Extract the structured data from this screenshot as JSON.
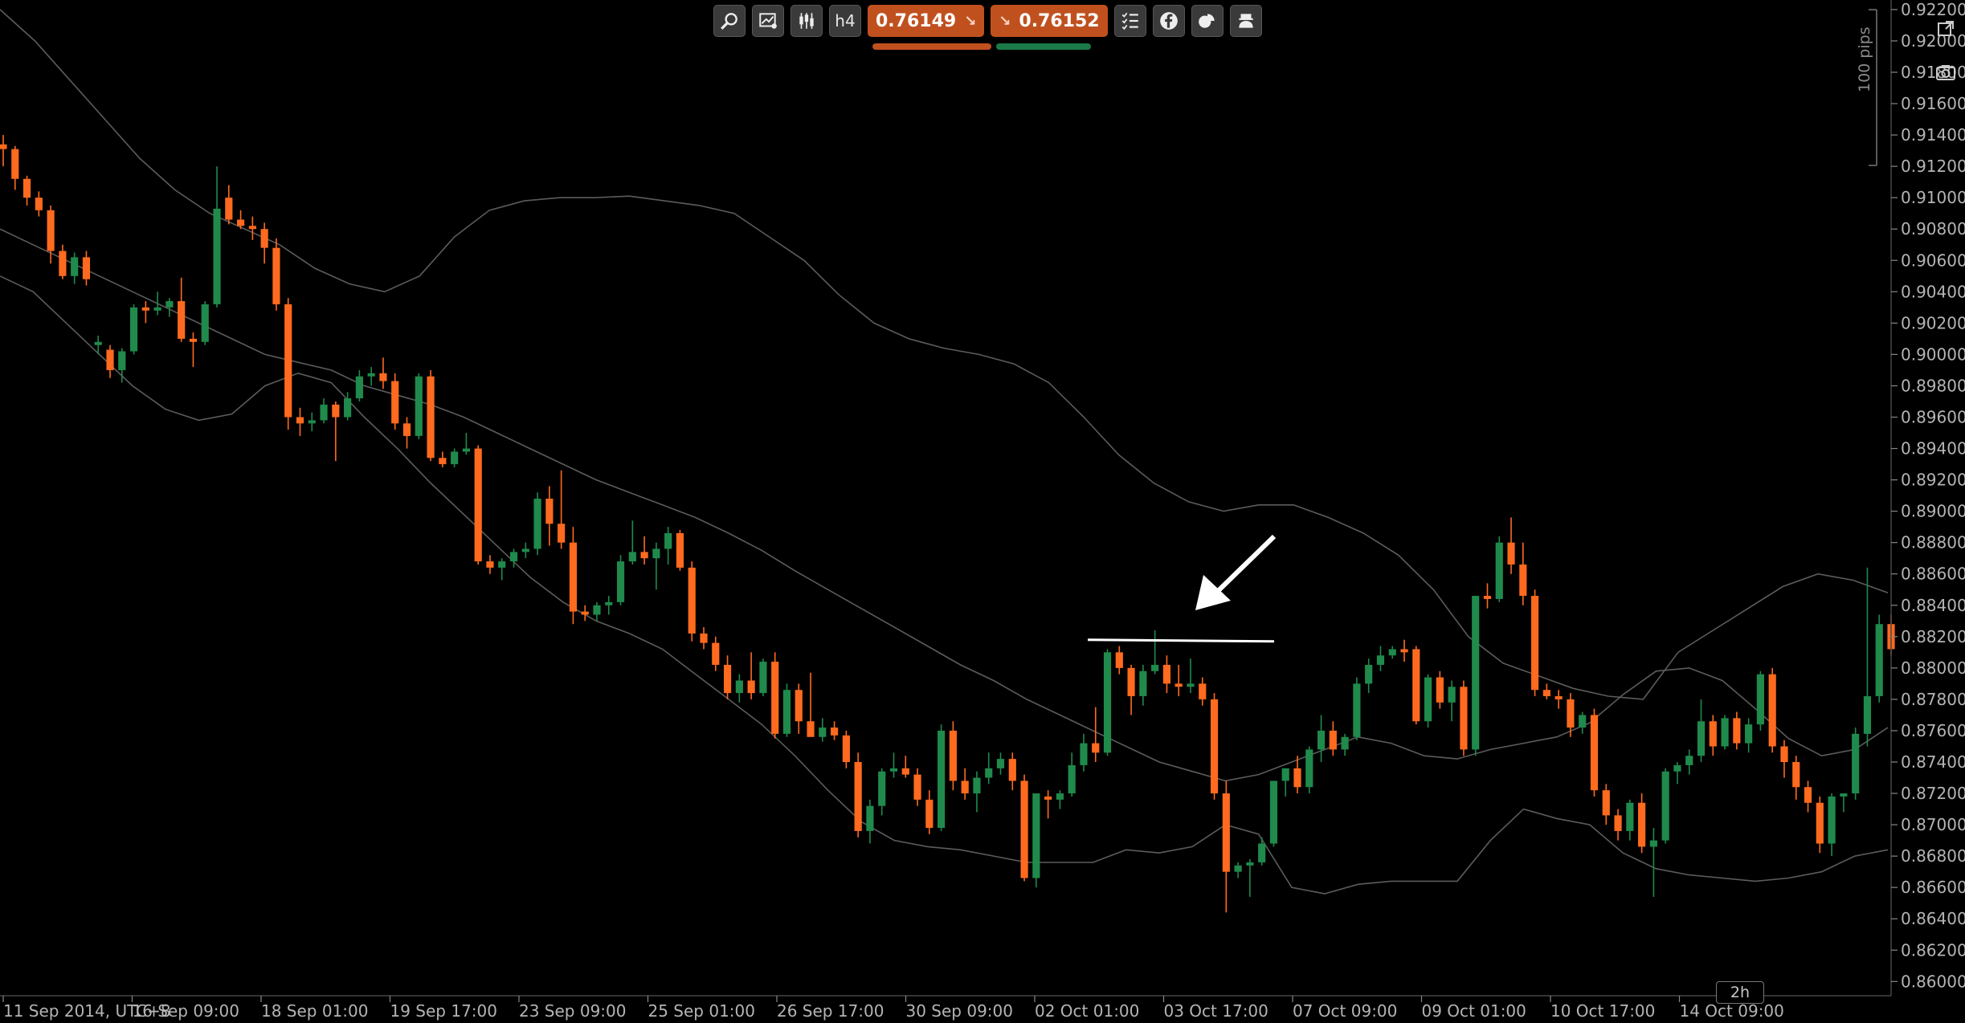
{
  "toolbar": {
    "icons": [
      "zoom-icon",
      "chart-settings-icon",
      "chart-type-icon",
      "timeframe-icon",
      "watchlist-icon",
      "social-icon",
      "sentiment-icon",
      "trader-icon"
    ],
    "timeframe": "h4",
    "sell_price": "0.76149",
    "buy_price": "0.76152",
    "sell_color": "#c0511f",
    "buy_color": "#c0511f",
    "sell_bar_color": "#c0511f",
    "buy_bar_color": "#1a7a48"
  },
  "side": {
    "pips_label": "100 pips",
    "timeframe_badge": "2h"
  },
  "chart_data": {
    "type": "candlestick",
    "bull_color": "#1f8a4c",
    "bear_color": "#ff6a1f",
    "band_color": "#5c5c5c",
    "y_ticks": [
      "0.92200",
      "0.92000",
      "0.91800",
      "0.91600",
      "0.91400",
      "0.91200",
      "0.91000",
      "0.90800",
      "0.90600",
      "0.90400",
      "0.90200",
      "0.90000",
      "0.89800",
      "0.89600",
      "0.89400",
      "0.89200",
      "0.89000",
      "0.88800",
      "0.88600",
      "0.88400",
      "0.88200",
      "0.88000",
      "0.87800",
      "0.87600",
      "0.87400",
      "0.87200",
      "0.87000",
      "0.86800",
      "0.86600",
      "0.86400",
      "0.86200",
      "0.86000"
    ],
    "x_ticks": [
      "11 Sep 2014, UTC+8",
      "16 Sep 09:00",
      "18 Sep 01:00",
      "19 Sep 17:00",
      "23 Sep 09:00",
      "25 Sep 01:00",
      "26 Sep 17:00",
      "30 Sep 09:00",
      "02 Oct 01:00",
      "03 Oct 17:00",
      "07 Oct 09:00",
      "09 Oct 01:00",
      "10 Oct 17:00",
      "14 Oct 09:00"
    ],
    "ylim": [
      0.8593,
      0.9222
    ],
    "candles": [
      [
        0.9134,
        0.914,
        0.912,
        0.9131
      ],
      [
        0.9131,
        0.9133,
        0.9105,
        0.9112
      ],
      [
        0.9112,
        0.9114,
        0.9095,
        0.91
      ],
      [
        0.91,
        0.9104,
        0.9088,
        0.9092
      ],
      [
        0.9092,
        0.9095,
        0.9058,
        0.9066
      ],
      [
        0.9066,
        0.907,
        0.9048,
        0.905
      ],
      [
        0.905,
        0.9065,
        0.9045,
        0.9062
      ],
      [
        0.9062,
        0.9066,
        0.9044,
        0.9048
      ],
      [
        0.9006,
        0.9012,
        0.9,
        0.9008
      ],
      [
        0.9003,
        0.9006,
        0.8985,
        0.899
      ],
      [
        0.899,
        0.9004,
        0.8982,
        0.9002
      ],
      [
        0.9002,
        0.9032,
        0.9,
        0.903
      ],
      [
        0.903,
        0.9034,
        0.902,
        0.9028
      ],
      [
        0.9028,
        0.904,
        0.9025,
        0.903
      ],
      [
        0.903,
        0.9036,
        0.9024,
        0.9034
      ],
      [
        0.9034,
        0.9049,
        0.9008,
        0.901
      ],
      [
        0.901,
        0.9014,
        0.8992,
        0.9008
      ],
      [
        0.9008,
        0.9034,
        0.9006,
        0.9032
      ],
      [
        0.9032,
        0.912,
        0.903,
        0.9093
      ],
      [
        0.91,
        0.9108,
        0.9083,
        0.9086
      ],
      [
        0.9086,
        0.9092,
        0.908,
        0.9082
      ],
      [
        0.9082,
        0.9088,
        0.9073,
        0.908
      ],
      [
        0.908,
        0.9084,
        0.9058,
        0.9068
      ],
      [
        0.9068,
        0.9074,
        0.9028,
        0.9032
      ],
      [
        0.9032,
        0.9036,
        0.8952,
        0.896
      ],
      [
        0.896,
        0.8966,
        0.8948,
        0.8956
      ],
      [
        0.8956,
        0.8963,
        0.8951,
        0.8958
      ],
      [
        0.8958,
        0.8972,
        0.8956,
        0.8968
      ],
      [
        0.8968,
        0.897,
        0.8932,
        0.896
      ],
      [
        0.896,
        0.8976,
        0.8958,
        0.8972
      ],
      [
        0.8972,
        0.899,
        0.897,
        0.8986
      ],
      [
        0.8986,
        0.8992,
        0.898,
        0.8988
      ],
      [
        0.8988,
        0.8998,
        0.8978,
        0.8983
      ],
      [
        0.8983,
        0.8988,
        0.8952,
        0.8956
      ],
      [
        0.8956,
        0.896,
        0.894,
        0.8948
      ],
      [
        0.8948,
        0.8988,
        0.8946,
        0.8986
      ],
      [
        0.8986,
        0.899,
        0.8932,
        0.8934
      ],
      [
        0.8934,
        0.8938,
        0.8928,
        0.893
      ],
      [
        0.893,
        0.894,
        0.8928,
        0.8938
      ],
      [
        0.8938,
        0.895,
        0.8936,
        0.894
      ],
      [
        0.894,
        0.8942,
        0.8866,
        0.8868
      ],
      [
        0.8868,
        0.8872,
        0.886,
        0.8864
      ],
      [
        0.8864,
        0.887,
        0.8856,
        0.8868
      ],
      [
        0.8868,
        0.8876,
        0.8864,
        0.8874
      ],
      [
        0.8874,
        0.888,
        0.887,
        0.8876
      ],
      [
        0.8876,
        0.8912,
        0.8872,
        0.8908
      ],
      [
        0.8908,
        0.8916,
        0.8878,
        0.8892
      ],
      [
        0.8892,
        0.8926,
        0.8876,
        0.888
      ],
      [
        0.888,
        0.889,
        0.8828,
        0.8836
      ],
      [
        0.8836,
        0.884,
        0.883,
        0.8834
      ],
      [
        0.8834,
        0.8842,
        0.883,
        0.884
      ],
      [
        0.884,
        0.8846,
        0.8834,
        0.8842
      ],
      [
        0.8842,
        0.8872,
        0.884,
        0.8868
      ],
      [
        0.8868,
        0.8894,
        0.8866,
        0.8874
      ],
      [
        0.8874,
        0.8884,
        0.8866,
        0.887
      ],
      [
        0.887,
        0.888,
        0.885,
        0.8876
      ],
      [
        0.8876,
        0.889,
        0.8866,
        0.8886
      ],
      [
        0.8886,
        0.8888,
        0.8862,
        0.8864
      ],
      [
        0.8864,
        0.8868,
        0.8817,
        0.8822
      ],
      [
        0.8822,
        0.8826,
        0.8812,
        0.8816
      ],
      [
        0.8816,
        0.882,
        0.8798,
        0.8802
      ],
      [
        0.8802,
        0.8808,
        0.878,
        0.8784
      ],
      [
        0.8784,
        0.8796,
        0.8778,
        0.8792
      ],
      [
        0.8792,
        0.881,
        0.878,
        0.8784
      ],
      [
        0.8784,
        0.8806,
        0.8782,
        0.8804
      ],
      [
        0.8804,
        0.881,
        0.8755,
        0.8758
      ],
      [
        0.8758,
        0.879,
        0.8756,
        0.8786
      ],
      [
        0.8786,
        0.879,
        0.8758,
        0.8766
      ],
      [
        0.8766,
        0.8797,
        0.876,
        0.8756
      ],
      [
        0.8756,
        0.8768,
        0.8753,
        0.8762
      ],
      [
        0.8762,
        0.8766,
        0.8754,
        0.8757
      ],
      [
        0.8757,
        0.876,
        0.8736,
        0.874
      ],
      [
        0.874,
        0.8746,
        0.8692,
        0.8696
      ],
      [
        0.8696,
        0.8716,
        0.8688,
        0.8712
      ],
      [
        0.8712,
        0.8736,
        0.8706,
        0.8734
      ],
      [
        0.8734,
        0.8746,
        0.873,
        0.8736
      ],
      [
        0.8736,
        0.8744,
        0.873,
        0.8732
      ],
      [
        0.8732,
        0.8736,
        0.8712,
        0.8716
      ],
      [
        0.8716,
        0.8722,
        0.8694,
        0.8698
      ],
      [
        0.8698,
        0.8764,
        0.8696,
        0.876
      ],
      [
        0.876,
        0.8766,
        0.8722,
        0.8728
      ],
      [
        0.8728,
        0.8736,
        0.8716,
        0.872
      ],
      [
        0.872,
        0.8734,
        0.8708,
        0.873
      ],
      [
        0.873,
        0.8746,
        0.8726,
        0.8736
      ],
      [
        0.8736,
        0.8746,
        0.8732,
        0.8742
      ],
      [
        0.8742,
        0.8746,
        0.8722,
        0.8728
      ],
      [
        0.8728,
        0.8732,
        0.8664,
        0.8666
      ],
      [
        0.8666,
        0.8672,
        0.866,
        0.872
      ],
      [
        0.8718,
        0.8722,
        0.8704,
        0.8716
      ],
      [
        0.8716,
        0.8722,
        0.871,
        0.872
      ],
      [
        0.872,
        0.8746,
        0.8718,
        0.8738
      ],
      [
        0.8738,
        0.8758,
        0.8734,
        0.8752
      ],
      [
        0.8752,
        0.8775,
        0.874,
        0.8746
      ],
      [
        0.8746,
        0.8812,
        0.8744,
        0.881
      ],
      [
        0.881,
        0.8814,
        0.8796,
        0.88
      ],
      [
        0.88,
        0.8802,
        0.877,
        0.8782
      ],
      [
        0.8782,
        0.8802,
        0.8776,
        0.8798
      ],
      [
        0.8798,
        0.8824,
        0.8796,
        0.8802
      ],
      [
        0.8802,
        0.8808,
        0.8784,
        0.879
      ],
      [
        0.879,
        0.8802,
        0.8782,
        0.8788
      ],
      [
        0.8788,
        0.8806,
        0.8784,
        0.879
      ],
      [
        0.879,
        0.8794,
        0.8776,
        0.878
      ],
      [
        0.878,
        0.8784,
        0.8716,
        0.872
      ],
      [
        0.872,
        0.8728,
        0.8644,
        0.867
      ],
      [
        0.867,
        0.8676,
        0.8666,
        0.8674
      ],
      [
        0.8674,
        0.8678,
        0.8654,
        0.8676
      ],
      [
        0.8676,
        0.8692,
        0.8674,
        0.8688
      ],
      [
        0.8688,
        0.8728,
        0.8686,
        0.8728
      ],
      [
        0.8728,
        0.8736,
        0.8718,
        0.8736
      ],
      [
        0.8736,
        0.8744,
        0.872,
        0.8724
      ],
      [
        0.8724,
        0.875,
        0.872,
        0.8748
      ],
      [
        0.8748,
        0.877,
        0.874,
        0.876
      ],
      [
        0.876,
        0.8766,
        0.8744,
        0.8748
      ],
      [
        0.8748,
        0.8758,
        0.8744,
        0.8756
      ],
      [
        0.8756,
        0.8794,
        0.8754,
        0.879
      ],
      [
        0.879,
        0.8806,
        0.8784,
        0.8802
      ],
      [
        0.8802,
        0.8814,
        0.8798,
        0.8808
      ],
      [
        0.8808,
        0.8814,
        0.8806,
        0.8812
      ],
      [
        0.8812,
        0.8818,
        0.8804,
        0.881
      ],
      [
        0.8812,
        0.8814,
        0.8764,
        0.8766
      ],
      [
        0.8766,
        0.8796,
        0.8762,
        0.8794
      ],
      [
        0.8794,
        0.8798,
        0.8774,
        0.8778
      ],
      [
        0.8778,
        0.8792,
        0.8766,
        0.8788
      ],
      [
        0.8788,
        0.8792,
        0.8744,
        0.8748
      ],
      [
        0.8748,
        0.8846,
        0.8744,
        0.8846
      ],
      [
        0.8846,
        0.8854,
        0.8838,
        0.8844
      ],
      [
        0.8844,
        0.8884,
        0.8842,
        0.888
      ],
      [
        0.888,
        0.8896,
        0.886,
        0.8866
      ],
      [
        0.8866,
        0.888,
        0.884,
        0.8846
      ],
      [
        0.8846,
        0.885,
        0.8782,
        0.8786
      ],
      [
        0.8786,
        0.879,
        0.878,
        0.8782
      ],
      [
        0.8782,
        0.8786,
        0.8774,
        0.878
      ],
      [
        0.878,
        0.8784,
        0.8756,
        0.8762
      ],
      [
        0.8762,
        0.8772,
        0.8758,
        0.877
      ],
      [
        0.877,
        0.8774,
        0.8718,
        0.8722
      ],
      [
        0.8722,
        0.8726,
        0.87,
        0.8706
      ],
      [
        0.8706,
        0.871,
        0.869,
        0.8696
      ],
      [
        0.8696,
        0.8716,
        0.869,
        0.8714
      ],
      [
        0.8714,
        0.872,
        0.8682,
        0.8686
      ],
      [
        0.8686,
        0.8698,
        0.8654,
        0.869
      ],
      [
        0.869,
        0.8736,
        0.8688,
        0.8734
      ],
      [
        0.8734,
        0.874,
        0.8726,
        0.8738
      ],
      [
        0.8738,
        0.8748,
        0.8732,
        0.8744
      ],
      [
        0.8744,
        0.878,
        0.874,
        0.8766
      ],
      [
        0.8766,
        0.877,
        0.8744,
        0.875
      ],
      [
        0.875,
        0.877,
        0.8748,
        0.8768
      ],
      [
        0.8768,
        0.8772,
        0.8748,
        0.8752
      ],
      [
        0.8752,
        0.8768,
        0.8746,
        0.8764
      ],
      [
        0.8764,
        0.8798,
        0.876,
        0.8796
      ],
      [
        0.8796,
        0.88,
        0.8746,
        0.875
      ],
      [
        0.875,
        0.8754,
        0.873,
        0.874
      ],
      [
        0.874,
        0.8744,
        0.8716,
        0.8724
      ],
      [
        0.8724,
        0.8728,
        0.8708,
        0.8714
      ],
      [
        0.8714,
        0.8718,
        0.8682,
        0.8688
      ],
      [
        0.8688,
        0.872,
        0.868,
        0.8718
      ],
      [
        0.8718,
        0.872,
        0.8708,
        0.872
      ],
      [
        0.872,
        0.8762,
        0.8716,
        0.8758
      ],
      [
        0.8758,
        0.8864,
        0.875,
        0.8782
      ],
      [
        0.8782,
        0.8834,
        0.8778,
        0.8828
      ],
      [
        0.8828,
        0.8834,
        0.8808,
        0.8812
      ]
    ],
    "upper_band": [
      0.922,
      0.92,
      0.9175,
      0.915,
      0.9125,
      0.9105,
      0.909,
      0.908,
      0.907,
      0.9055,
      0.9045,
      0.904,
      0.905,
      0.9075,
      0.9092,
      0.9098,
      0.91,
      0.91,
      0.9101,
      0.9098,
      0.9095,
      0.909,
      0.9075,
      0.906,
      0.9038,
      0.902,
      0.901,
      0.9004,
      0.9,
      0.8994,
      0.8982,
      0.896,
      0.8936,
      0.8918,
      0.8906,
      0.89,
      0.8904,
      0.8904,
      0.8896,
      0.8886,
      0.8872,
      0.885,
      0.882,
      0.8803,
      0.8795,
      0.8787,
      0.8782,
      0.878,
      0.881,
      0.8824,
      0.8838,
      0.8852,
      0.886,
      0.8856,
      0.8848
    ],
    "middle_band": [
      0.908,
      0.907,
      0.906,
      0.905,
      0.904,
      0.903,
      0.902,
      0.901,
      0.9,
      0.8995,
      0.899,
      0.898,
      0.8974,
      0.8968,
      0.896,
      0.895,
      0.894,
      0.893,
      0.892,
      0.8912,
      0.8904,
      0.8896,
      0.8886,
      0.8875,
      0.8862,
      0.885,
      0.8838,
      0.8826,
      0.8814,
      0.8802,
      0.8792,
      0.878,
      0.877,
      0.876,
      0.875,
      0.874,
      0.8734,
      0.8728,
      0.8732,
      0.874,
      0.8748,
      0.8756,
      0.8752,
      0.8744,
      0.8742,
      0.8748,
      0.8752,
      0.8756,
      0.8765,
      0.8783,
      0.8798,
      0.88,
      0.8792,
      0.8774,
      0.8755,
      0.8744,
      0.8748,
      0.8762
    ],
    "lower_band": [
      0.905,
      0.904,
      0.902,
      0.9,
      0.898,
      0.8965,
      0.8958,
      0.8962,
      0.898,
      0.8988,
      0.8982,
      0.896,
      0.894,
      0.8918,
      0.8898,
      0.8878,
      0.8858,
      0.8842,
      0.883,
      0.8822,
      0.8812,
      0.8796,
      0.878,
      0.8764,
      0.8744,
      0.8722,
      0.8702,
      0.869,
      0.8686,
      0.8684,
      0.868,
      0.8676,
      0.8676,
      0.8676,
      0.8684,
      0.8682,
      0.8686,
      0.87,
      0.8694,
      0.866,
      0.8656,
      0.8662,
      0.8664,
      0.8664,
      0.8664,
      0.869,
      0.871,
      0.8704,
      0.87,
      0.8682,
      0.8672,
      0.8668,
      0.8666,
      0.8664,
      0.8666,
      0.867,
      0.868,
      0.8684
    ],
    "horizontal_level": 0.8818,
    "annotation": "arrow"
  }
}
